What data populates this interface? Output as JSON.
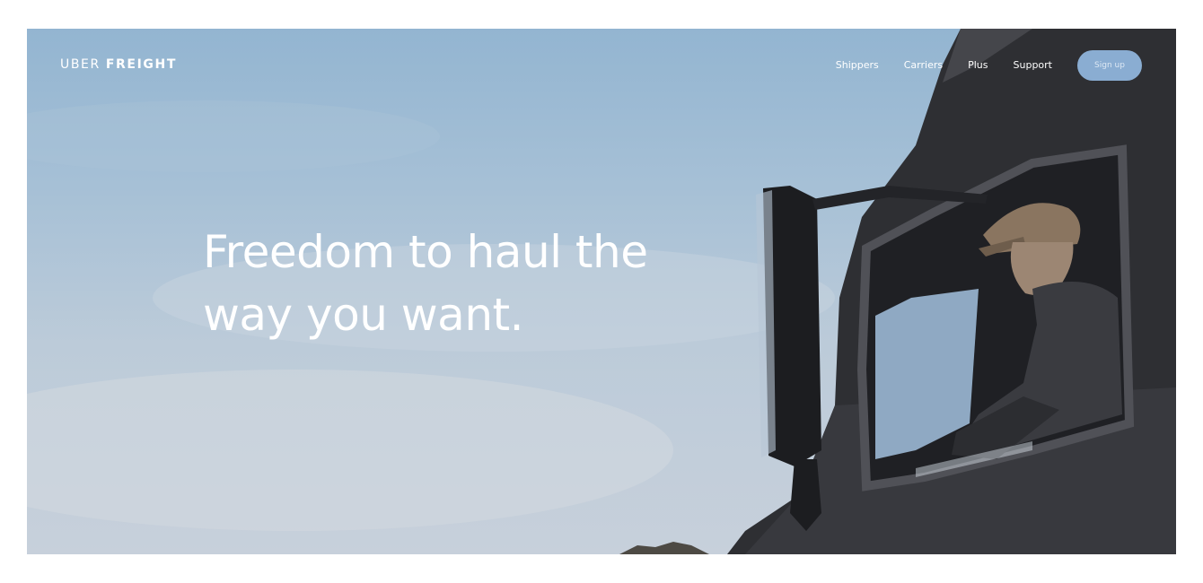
{
  "brand": {
    "word1": "UBER",
    "word2": "FREIGHT"
  },
  "nav": {
    "items": [
      {
        "label": "Shippers"
      },
      {
        "label": "Carriers"
      },
      {
        "label": "Plus"
      },
      {
        "label": "Support"
      }
    ],
    "signup_label": "Sign up"
  },
  "hero": {
    "headline_line1": "Freedom to haul the",
    "headline_line2": "way you want.",
    "photo_description_icon": "truck-driver-photo"
  },
  "colors": {
    "sky_top": "#93b5d1",
    "sky_bottom": "#c7d0db",
    "truck": "#2f3034",
    "signup_button": "#8aadd2",
    "text": "#ffffff"
  }
}
